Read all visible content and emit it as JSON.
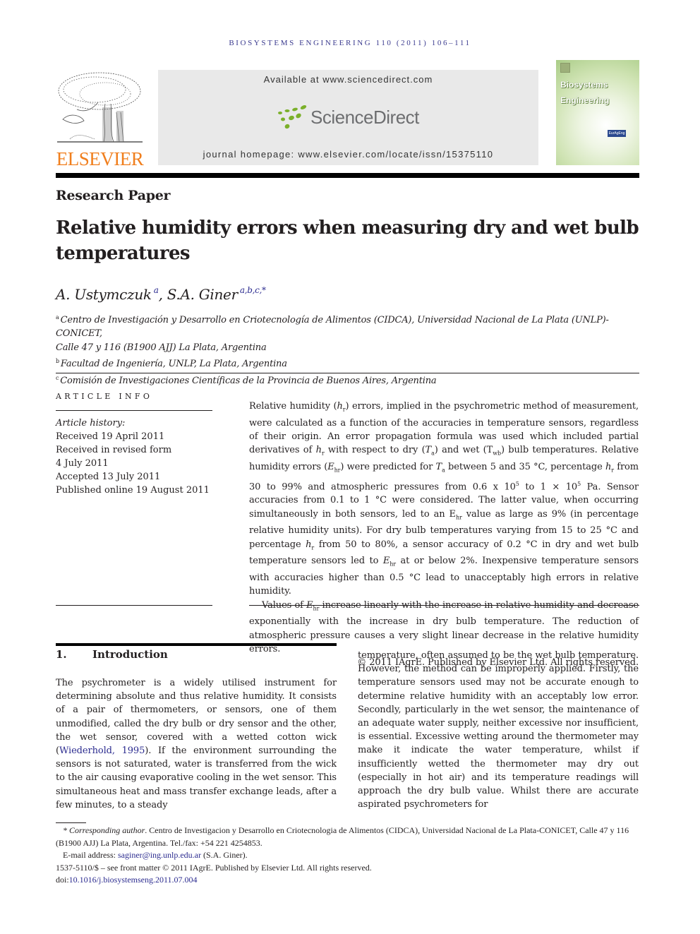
{
  "running_header": "BIOSYSTEMS ENGINEERING 110 (2011) 106–111",
  "masthead": {
    "publisher_logo_text": "ELSEVIER",
    "available_at": "Available at www.sciencedirect.com",
    "platform_name": "ScienceDirect",
    "journal_homepage": "journal homepage: www.elsevier.com/locate/issn/15375110",
    "cover_title_line1": "Biosystems",
    "cover_title_line2": "Engineering",
    "cover_badge": "EurAgEng",
    "colors": {
      "elsevier_orange": "#f07f1e",
      "sciencedirect_green": "#7bb02a",
      "link_blue": "#2b2b8f"
    }
  },
  "article_type": "Research Paper",
  "title": "Relative humidity errors when measuring dry and wet bulb temperatures",
  "authors": [
    {
      "name": "A. Ustymczuk",
      "affil": "a",
      "sep": ", "
    },
    {
      "name": "S.A. Giner",
      "affil": "a,b,c,*",
      "sep": ""
    }
  ],
  "affiliations": [
    {
      "key": "a",
      "text": "Centro de Investigación y Desarrollo en Criotecnología de Alimentos (CIDCA), Universidad Nacional de La Plata (UNLP)-CONICET,",
      "text2": "Calle 47 y 116 (B1900 AJJ) La Plata, Argentina"
    },
    {
      "key": "b",
      "text": "Facultad de Ingeniería, UNLP, La Plata, Argentina"
    },
    {
      "key": "c",
      "text": "Comisión de Investigaciones Científicas de la Provincia de Buenos Aires, Argentina"
    }
  ],
  "article_info": {
    "heading": "ARTICLE INFO",
    "history_label": "Article history:",
    "history": [
      "Received 19 April 2011",
      "Received in revised form",
      "4 July 2011",
      "Accepted 13 July 2011",
      "Published online 19 August 2011"
    ]
  },
  "abstract": {
    "p1": [
      "Relative humidity (",
      "h",
      "r",
      ") errors, implied in the psychrometric method of measurement, were calculated as a function of the accuracies in temperature sensors, regardless of their origin. An error propagation formula was used which included partial derivatives of ",
      "h",
      "r",
      " with respect to dry (",
      "T",
      "a",
      ") and wet (T",
      "wb",
      ") bulb temperatures. Relative humidity errors (",
      "E",
      "hr",
      ") were predicted for ",
      "T",
      "a",
      " between 5 and 35 °C, percentage ",
      "h",
      "r",
      " from 30 to 99% and atmospheric pressures from 0.6 x 10",
      "5",
      " to 1 × 10",
      "5",
      " Pa. Sensor accuracies from 0.1 to 1 °C were considered. The latter value, when occurring simultaneously in both sensors, led to an E",
      "hr",
      " value as large as 9% (in percentage relative humidity units). For dry bulb temperatures varying from 15 to 25 °C and percentage ",
      "h",
      "r",
      " from 50 to 80%, a sensor accuracy of 0.2 °C in dry and wet bulb temperature sensors led to ",
      "E",
      "hr",
      " at or below 2%. Inexpensive temperature sensors with accuracies higher than 0.5 °C lead to unacceptably high errors in relative humidity."
    ],
    "p2": [
      "Values of ",
      "E",
      "hr",
      " increase linearly with the increase in relative humidity and decrease exponentially with the increase in dry bulb temperature. The reduction of atmospheric pressure causes a very slight linear decrease in the relative humidity errors."
    ],
    "copyright": "© 2011 IAgrE. Published by Elsevier Ltd. All rights reserved."
  },
  "introduction": {
    "number": "1.",
    "heading": "Introduction",
    "left_before_link": "The psychrometer is a widely utilised instrument for determining absolute and thus relative humidity. It consists of a pair of thermometers, or sensors, one of them unmodified, called the dry bulb or dry sensor and the other, the wet sensor, covered with a wetted cotton wick (",
    "citation": "Wiederhold, 1995",
    "left_after_link": "). If the environment surrounding the sensors is not saturated, water is transferred from the wick to the air causing evaporative cooling in the wet sensor. This simultaneous heat and mass transfer exchange leads, after a few minutes, to a steady",
    "right": "temperature, often assumed to be the wet bulb temperature. However, the method can be improperly applied. Firstly, the temperature sensors used may not be accurate enough to determine relative humidity with an acceptably low error. Secondly, particularly in the wet sensor, the maintenance of an adequate water supply, neither excessive nor insufficient, is essential. Excessive wetting around the thermometer may make it indicate the water temperature, whilst if insufficiently wetted the thermometer may dry out (especially in hot air) and its temperature readings will approach the dry bulb value. Whilst there are accurate aspirated psychrometers for"
  },
  "footnotes": {
    "corresponding_label": "* Corresponding author",
    "corresponding_text": ". Centro de Investigacion y Desarrollo en Criotecnologia de Alimentos (CIDCA), Universidad Nacional de La Plata-CONICET, Calle 47 y 116 (B1900 AJJ) La Plata, Argentina. Tel./fax: +54 221 4254853.",
    "email_label": "E-mail address: ",
    "email": "saginer@ing.unlp.edu.ar",
    "email_owner": " (S.A. Giner).",
    "front_matter": "1537-5110/$ – see front matter © 2011 IAgrE. Published by Elsevier Ltd. All rights reserved.",
    "doi_label": "doi:",
    "doi": "10.1016/j.biosystemseng.2011.07.004"
  }
}
